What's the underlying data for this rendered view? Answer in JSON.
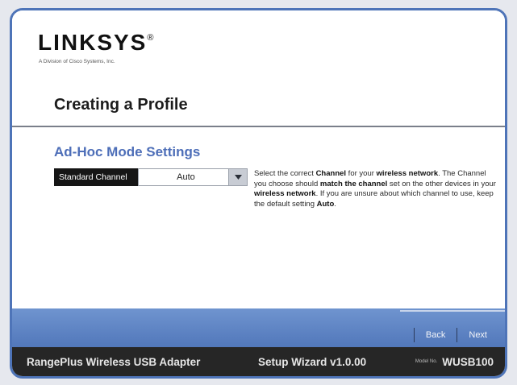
{
  "brand": {
    "name": "LINKSYS",
    "registered_mark": "®",
    "subtitle": "A Division of Cisco Systems, Inc."
  },
  "page_title": "Creating a Profile",
  "section_title": "Ad-Hoc Mode Settings",
  "channel_field": {
    "label": "Standard Channel",
    "value": "Auto"
  },
  "help": {
    "p1": "Select the correct ",
    "b1": "Channel",
    "p2": " for your ",
    "b2": "wireless network",
    "p3": ". The Channel you choose should ",
    "b3": "match the channel",
    "p4": " set on the other devices in your ",
    "b4": "wireless network",
    "p5": ". If you are unsure about which channel to use, keep the default setting ",
    "b5": "Auto",
    "p6": "."
  },
  "nav": {
    "back_label": "Back",
    "next_label": "Next"
  },
  "bottom": {
    "product": "RangePlus Wireless USB Adapter",
    "wizard": "Setup Wizard  v1.0.00",
    "model_label": "Model No.",
    "model": "WUSB100"
  },
  "colors": {
    "frame_blue": "#4e74b8",
    "section_blue": "#4d6eb8",
    "bottom_bar": "#262626"
  }
}
